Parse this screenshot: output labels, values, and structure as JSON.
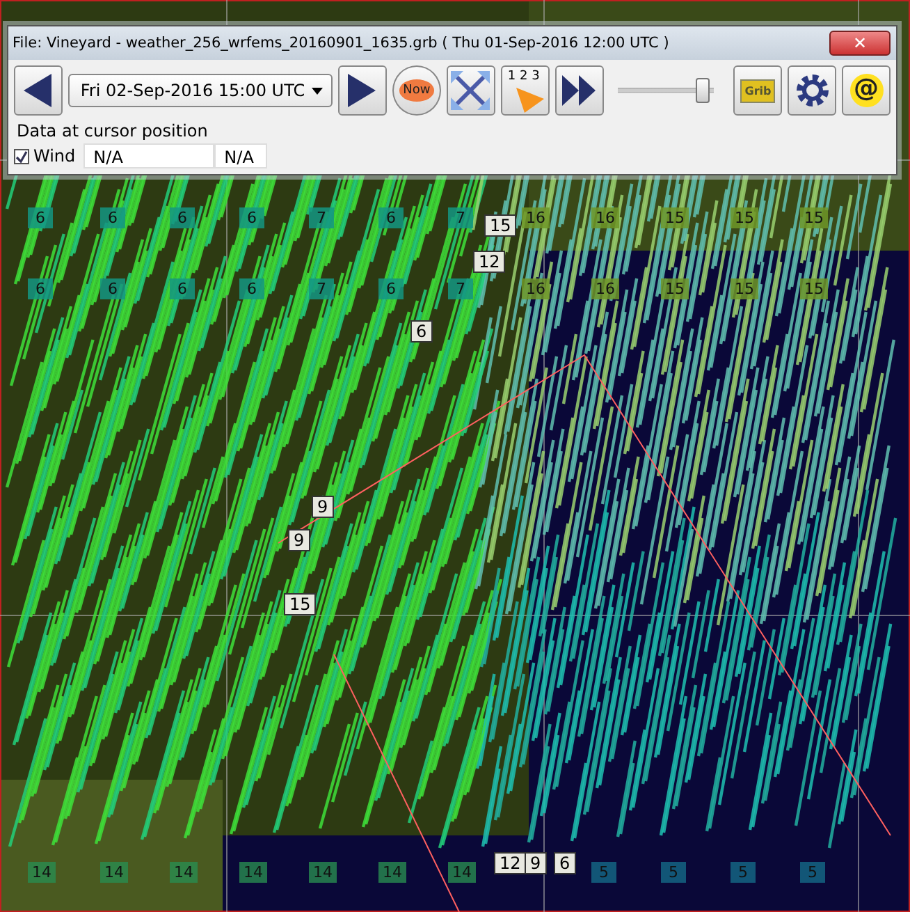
{
  "window": {
    "title": "File: Vineyard - weather_256_wrfems_20160901_1635.grb ( Thu 01-Sep-2016 12:00  UTC )",
    "close_button": "✕"
  },
  "toolbar": {
    "date_select": "Fri 02-Sep-2016 15:00  UTC",
    "now_button": "Now",
    "step_counter": "1 2 3",
    "grib_button": "Grib",
    "email_button": "@",
    "time_slider": {
      "level": 0.88
    }
  },
  "cursor_data": {
    "heading": "Data at cursor position",
    "layers": [
      {
        "label": "Wind",
        "checked": true,
        "value_1": "N/A",
        "value_2": "N/A"
      }
    ]
  },
  "map": {
    "grid_rows": [
      {
        "values": [
          "6",
          "6",
          "6",
          "6",
          "7",
          "6",
          "7",
          "16",
          "16",
          "15",
          "15",
          "15"
        ]
      },
      {
        "values": [
          "6",
          "6",
          "6",
          "6",
          "7",
          "6",
          "7",
          "16",
          "16",
          "15",
          "15",
          "15"
        ]
      },
      {
        "values": [
          "14",
          "14",
          "14",
          "14",
          "14",
          "14",
          "14",
          "5",
          "5",
          "5",
          "5"
        ]
      }
    ],
    "callouts": [
      {
        "text": "15"
      },
      {
        "text": "12"
      },
      {
        "text": "6"
      },
      {
        "text": "9"
      },
      {
        "text": "9"
      },
      {
        "text": "15"
      },
      {
        "text": "12"
      },
      {
        "text": "9"
      },
      {
        "text": "6"
      }
    ]
  }
}
